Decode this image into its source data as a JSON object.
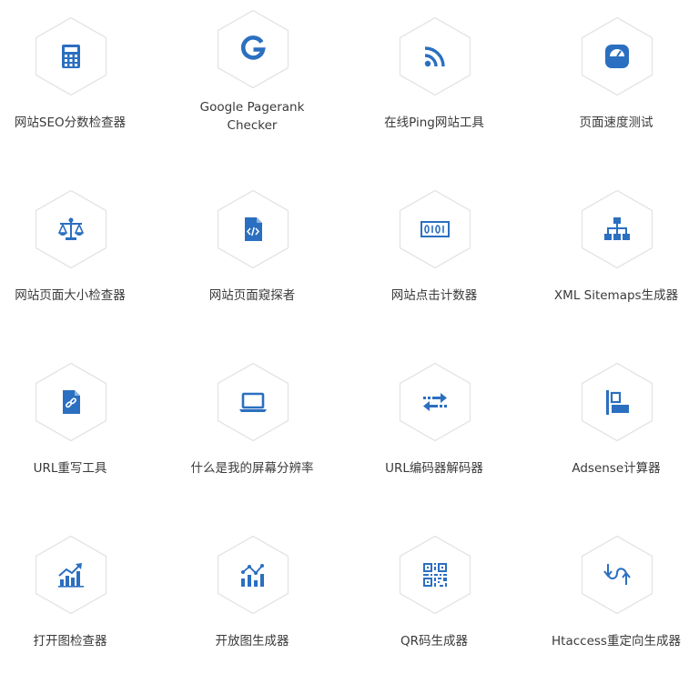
{
  "accent_color": "#2b6fc0",
  "tools": [
    {
      "label": "网站SEO分数检查器",
      "icon": "calculator-icon"
    },
    {
      "label": "Google Pagerank\nChecker",
      "icon": "google-icon"
    },
    {
      "label": "在线Ping网站工具",
      "icon": "rss-icon"
    },
    {
      "label": "页面速度测试",
      "icon": "speed-gauge-icon"
    },
    {
      "label": "网站页面大小检查器",
      "icon": "balance-scale-icon"
    },
    {
      "label": "网站页面窥探者",
      "icon": "code-file-icon"
    },
    {
      "label": "网站点击计数器",
      "icon": "binary-counter-icon"
    },
    {
      "label": "XML Sitemaps生成器",
      "icon": "sitemap-icon"
    },
    {
      "label": "URL重写工具",
      "icon": "link-file-icon"
    },
    {
      "label": "什么是我的屏幕分辨率",
      "icon": "laptop-icon"
    },
    {
      "label": "URL编码器解码器",
      "icon": "exchange-arrows-icon"
    },
    {
      "label": "Adsense计算器",
      "icon": "ad-layout-icon"
    },
    {
      "label": "打开图检查器",
      "icon": "growth-chart-icon"
    },
    {
      "label": "开放图生成器",
      "icon": "bar-line-chart-icon"
    },
    {
      "label": "QR码生成器",
      "icon": "qr-code-icon"
    },
    {
      "label": "Htaccess重定向生成器",
      "icon": "redirect-arrows-icon"
    }
  ]
}
